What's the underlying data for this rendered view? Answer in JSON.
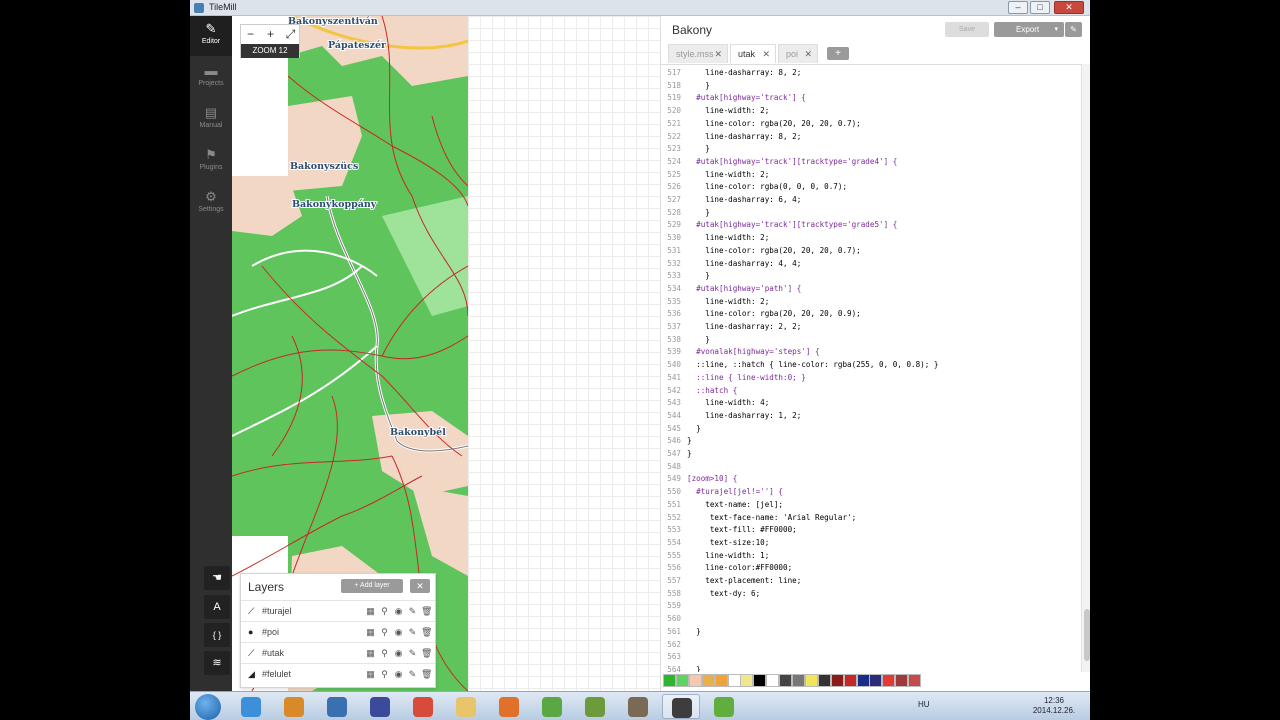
{
  "window": {
    "app_title": "TileMill",
    "minimize": "–",
    "restore": "▫",
    "maximize": "□",
    "close": "✕"
  },
  "sidebar": {
    "items": [
      {
        "label": "Editor",
        "icon": "pencil-icon",
        "glyph": "✎",
        "active": true
      },
      {
        "label": "Projects",
        "icon": "folder-icon",
        "glyph": "▬"
      },
      {
        "label": "Manual",
        "icon": "book-icon",
        "glyph": "▤"
      },
      {
        "label": "Plugins",
        "icon": "plugin-icon",
        "glyph": "⚑"
      },
      {
        "label": "Settings",
        "icon": "gear-icon",
        "glyph": "⚙"
      }
    ],
    "tools": [
      {
        "name": "hand-tool",
        "glyph": "☚"
      },
      {
        "name": "font-tool",
        "glyph": "A"
      },
      {
        "name": "carto-reference-tool",
        "glyph": "{ }"
      },
      {
        "name": "layers-tool",
        "glyph": "≋"
      }
    ]
  },
  "map": {
    "zoom_label": "ZOOM 12",
    "zoom_out": "−",
    "zoom_in": "+",
    "fullscreen": "⤢",
    "place_labels": [
      "Bakonyszentiván",
      "Pápateszér",
      "Bakonyszücs",
      "Bakonykoppány",
      "Bakonybél"
    ],
    "colors": {
      "forest": "#5fc45c",
      "open": "#f1d7c4",
      "roads": "#c62828",
      "main_road": "#f4c542"
    }
  },
  "layers": {
    "title": "Layers",
    "add_label": "Add layer",
    "close_glyph": "✕",
    "items": [
      {
        "name": "#turajel",
        "type": "line",
        "glyph": "⟋"
      },
      {
        "name": "#poi",
        "type": "point",
        "glyph": "●"
      },
      {
        "name": "#utak",
        "type": "line",
        "glyph": "⟋"
      },
      {
        "name": "#felulet",
        "type": "polygon",
        "glyph": "◢"
      }
    ],
    "actions": [
      "▦",
      "⚲",
      "◉",
      "✎",
      "🗑"
    ]
  },
  "editor": {
    "project_title": "Bakony",
    "save_label": "Save",
    "export_label": "Export",
    "export_caret": "▾",
    "wrench_glyph": "✎",
    "tabs": [
      {
        "label": "style.mss",
        "active": false
      },
      {
        "label": "utak",
        "active": true
      },
      {
        "label": "poi",
        "active": false
      }
    ],
    "add_tab": "+",
    "code_lines": [
      {
        "n": "517",
        "code": "    line-dasharray: 8, 2;"
      },
      {
        "n": "518",
        "code": "    }"
      },
      {
        "n": "519",
        "code": "  #utak[highway='track'] {"
      },
      {
        "n": "520",
        "code": "    line-width: 2;"
      },
      {
        "n": "521",
        "code": "    line-color: rgba(20, 20, 20, 0.7);"
      },
      {
        "n": "522",
        "code": "    line-dasharray: 8, 2;"
      },
      {
        "n": "523",
        "code": "    }"
      },
      {
        "n": "524",
        "code": "  #utak[highway='track'][tracktype='grade4'] {"
      },
      {
        "n": "525",
        "code": "    line-width: 2;"
      },
      {
        "n": "526",
        "code": "    line-color: rgba(0, 0, 0, 0.7);"
      },
      {
        "n": "527",
        "code": "    line-dasharray: 6, 4;"
      },
      {
        "n": "528",
        "code": "    }"
      },
      {
        "n": "529",
        "code": "  #utak[highway='track'][tracktype='grade5'] {"
      },
      {
        "n": "530",
        "code": "    line-width: 2;"
      },
      {
        "n": "531",
        "code": "    line-color: rgba(20, 20, 20, 0.7);"
      },
      {
        "n": "532",
        "code": "    line-dasharray: 4, 4;"
      },
      {
        "n": "533",
        "code": "    }"
      },
      {
        "n": "534",
        "code": "  #utak[highway='path'] {"
      },
      {
        "n": "535",
        "code": "    line-width: 2;"
      },
      {
        "n": "536",
        "code": "    line-color: rgba(20, 20, 20, 0.9);"
      },
      {
        "n": "537",
        "code": "    line-dasharray: 2, 2;"
      },
      {
        "n": "538",
        "code": "    }"
      },
      {
        "n": "539",
        "code": "  #vonalak[highway='steps'] {"
      },
      {
        "n": "540",
        "code": "  ::line, ::hatch { line-color: rgba(255, 0, 0, 0.8); }"
      },
      {
        "n": "541",
        "code": "  ::line { line-width:0; }"
      },
      {
        "n": "542",
        "code": "  ::hatch {"
      },
      {
        "n": "543",
        "code": "    line-width: 4;"
      },
      {
        "n": "544",
        "code": "    line-dasharray: 1, 2;"
      },
      {
        "n": "545",
        "code": "  }"
      },
      {
        "n": "546",
        "code": "}"
      },
      {
        "n": "547",
        "code": "}"
      },
      {
        "n": "548",
        "code": ""
      },
      {
        "n": "549",
        "code": "[zoom>10] {"
      },
      {
        "n": "550",
        "code": "  #turajel[jel!=''] {"
      },
      {
        "n": "551",
        "code": "    text-name: [jel];"
      },
      {
        "n": "552",
        "code": "     text-face-name: 'Arial Regular';"
      },
      {
        "n": "553",
        "code": "     text-fill: #FF0000;"
      },
      {
        "n": "554",
        "code": "     text-size:10;"
      },
      {
        "n": "555",
        "code": "    line-width: 1;"
      },
      {
        "n": "556",
        "code": "    line-color:#FF0000;"
      },
      {
        "n": "557",
        "code": "    text-placement: line;"
      },
      {
        "n": "558",
        "code": "     text-dy: 6;"
      },
      {
        "n": "559",
        "code": ""
      },
      {
        "n": "560",
        "code": ""
      },
      {
        "n": "561",
        "code": "  }"
      },
      {
        "n": "562",
        "code": ""
      },
      {
        "n": "563",
        "code": ""
      },
      {
        "n": "564",
        "code": "  }"
      }
    ],
    "palette": [
      "#2db52d",
      "#5fd35f",
      "#f3c9b0",
      "#e8b04a",
      "#f2a23a",
      "#ffffff",
      "#f0e68c",
      "#000000",
      "#ffffff",
      "#444444",
      "#777777",
      "#f2e55a",
      "#333333",
      "#8b1a1a",
      "#c62828",
      "#1a2d8b",
      "#2b2b7a",
      "#e53935",
      "#9e3a3a",
      "#c44b4b"
    ]
  },
  "taskbar": {
    "apps": [
      {
        "name": "chrome-like-app",
        "color": "#3c8fd9"
      },
      {
        "name": "explorer-app",
        "color": "#d88a2a"
      },
      {
        "name": "thunderbird-app",
        "color": "#3a6fb0"
      },
      {
        "name": "save-app",
        "color": "#3b4a9a"
      },
      {
        "name": "chrome-app",
        "color": "#d84a3a"
      },
      {
        "name": "folder-app",
        "color": "#e8c56a"
      },
      {
        "name": "firefox-app",
        "color": "#e0702a"
      },
      {
        "name": "utorrent-app",
        "color": "#5aa843"
      },
      {
        "name": "notepad-app",
        "color": "#6d9a3a"
      },
      {
        "name": "gimp-app",
        "color": "#7a6a55"
      },
      {
        "name": "tilemill-app",
        "color": "#3d3d3d"
      },
      {
        "name": "scribus-app",
        "color": "#5fae3e"
      }
    ],
    "lang": "HU",
    "time": "12:36",
    "date": "2014.12.26."
  }
}
